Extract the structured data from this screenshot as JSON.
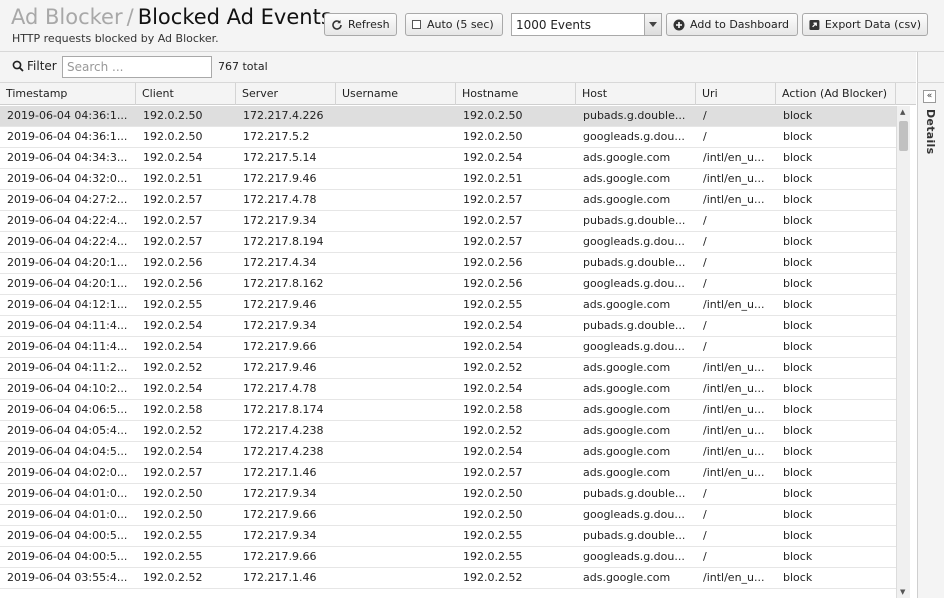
{
  "header": {
    "breadcrumb": "Ad Blocker",
    "separator": "/",
    "title": "Blocked Ad Events",
    "subtitle": "HTTP requests blocked by Ad Blocker."
  },
  "toolbar": {
    "refresh_label": "Refresh",
    "auto_label": "Auto (5 sec)",
    "events_selected": "1000 Events",
    "add_dashboard_label": "Add to Dashboard",
    "export_label": "Export Data (csv)"
  },
  "filter": {
    "label": "Filter",
    "placeholder": "Search ...",
    "total": "767 total"
  },
  "details_label": "Details",
  "columns": [
    "Timestamp",
    "Client",
    "Server",
    "Username",
    "Hostname",
    "Host",
    "Uri",
    "Action (Ad Blocker)"
  ],
  "rows": [
    [
      "2019-06-04 04:36:1...",
      "192.0.2.50",
      "172.217.4.226",
      "",
      "192.0.2.50",
      "pubads.g.double...",
      "/",
      "block"
    ],
    [
      "2019-06-04 04:36:1...",
      "192.0.2.50",
      "172.217.5.2",
      "",
      "192.0.2.50",
      "googleads.g.dou...",
      "/",
      "block"
    ],
    [
      "2019-06-04 04:34:3...",
      "192.0.2.54",
      "172.217.5.14",
      "",
      "192.0.2.54",
      "ads.google.com",
      "/intl/en_u...",
      "block"
    ],
    [
      "2019-06-04 04:32:0...",
      "192.0.2.51",
      "172.217.9.46",
      "",
      "192.0.2.51",
      "ads.google.com",
      "/intl/en_u...",
      "block"
    ],
    [
      "2019-06-04 04:27:2...",
      "192.0.2.57",
      "172.217.4.78",
      "",
      "192.0.2.57",
      "ads.google.com",
      "/intl/en_u...",
      "block"
    ],
    [
      "2019-06-04 04:22:4...",
      "192.0.2.57",
      "172.217.9.34",
      "",
      "192.0.2.57",
      "pubads.g.double...",
      "/",
      "block"
    ],
    [
      "2019-06-04 04:22:4...",
      "192.0.2.57",
      "172.217.8.194",
      "",
      "192.0.2.57",
      "googleads.g.dou...",
      "/",
      "block"
    ],
    [
      "2019-06-04 04:20:1...",
      "192.0.2.56",
      "172.217.4.34",
      "",
      "192.0.2.56",
      "pubads.g.double...",
      "/",
      "block"
    ],
    [
      "2019-06-04 04:20:1...",
      "192.0.2.56",
      "172.217.8.162",
      "",
      "192.0.2.56",
      "googleads.g.dou...",
      "/",
      "block"
    ],
    [
      "2019-06-04 04:12:1...",
      "192.0.2.55",
      "172.217.9.46",
      "",
      "192.0.2.55",
      "ads.google.com",
      "/intl/en_u...",
      "block"
    ],
    [
      "2019-06-04 04:11:4...",
      "192.0.2.54",
      "172.217.9.34",
      "",
      "192.0.2.54",
      "pubads.g.double...",
      "/",
      "block"
    ],
    [
      "2019-06-04 04:11:4...",
      "192.0.2.54",
      "172.217.9.66",
      "",
      "192.0.2.54",
      "googleads.g.dou...",
      "/",
      "block"
    ],
    [
      "2019-06-04 04:11:2...",
      "192.0.2.52",
      "172.217.9.46",
      "",
      "192.0.2.52",
      "ads.google.com",
      "/intl/en_u...",
      "block"
    ],
    [
      "2019-06-04 04:10:2...",
      "192.0.2.54",
      "172.217.4.78",
      "",
      "192.0.2.54",
      "ads.google.com",
      "/intl/en_u...",
      "block"
    ],
    [
      "2019-06-04 04:06:5...",
      "192.0.2.58",
      "172.217.8.174",
      "",
      "192.0.2.58",
      "ads.google.com",
      "/intl/en_u...",
      "block"
    ],
    [
      "2019-06-04 04:05:4...",
      "192.0.2.52",
      "172.217.4.238",
      "",
      "192.0.2.52",
      "ads.google.com",
      "/intl/en_u...",
      "block"
    ],
    [
      "2019-06-04 04:04:5...",
      "192.0.2.54",
      "172.217.4.238",
      "",
      "192.0.2.54",
      "ads.google.com",
      "/intl/en_u...",
      "block"
    ],
    [
      "2019-06-04 04:02:0...",
      "192.0.2.57",
      "172.217.1.46",
      "",
      "192.0.2.57",
      "ads.google.com",
      "/intl/en_u...",
      "block"
    ],
    [
      "2019-06-04 04:01:0...",
      "192.0.2.50",
      "172.217.9.34",
      "",
      "192.0.2.50",
      "pubads.g.double...",
      "/",
      "block"
    ],
    [
      "2019-06-04 04:01:0...",
      "192.0.2.50",
      "172.217.9.66",
      "",
      "192.0.2.50",
      "googleads.g.dou...",
      "/",
      "block"
    ],
    [
      "2019-06-04 04:00:5...",
      "192.0.2.55",
      "172.217.9.34",
      "",
      "192.0.2.55",
      "pubads.g.double...",
      "/",
      "block"
    ],
    [
      "2019-06-04 04:00:5...",
      "192.0.2.55",
      "172.217.9.66",
      "",
      "192.0.2.55",
      "googleads.g.dou...",
      "/",
      "block"
    ],
    [
      "2019-06-04 03:55:4...",
      "192.0.2.52",
      "172.217.1.46",
      "",
      "192.0.2.52",
      "ads.google.com",
      "/intl/en_u...",
      "block"
    ]
  ],
  "selected_row": 0,
  "icons": {
    "refresh": "refresh-icon",
    "add": "plus-circle-icon",
    "export": "export-icon",
    "filter": "search-icon",
    "collapse": "double-chevron-left-icon"
  }
}
